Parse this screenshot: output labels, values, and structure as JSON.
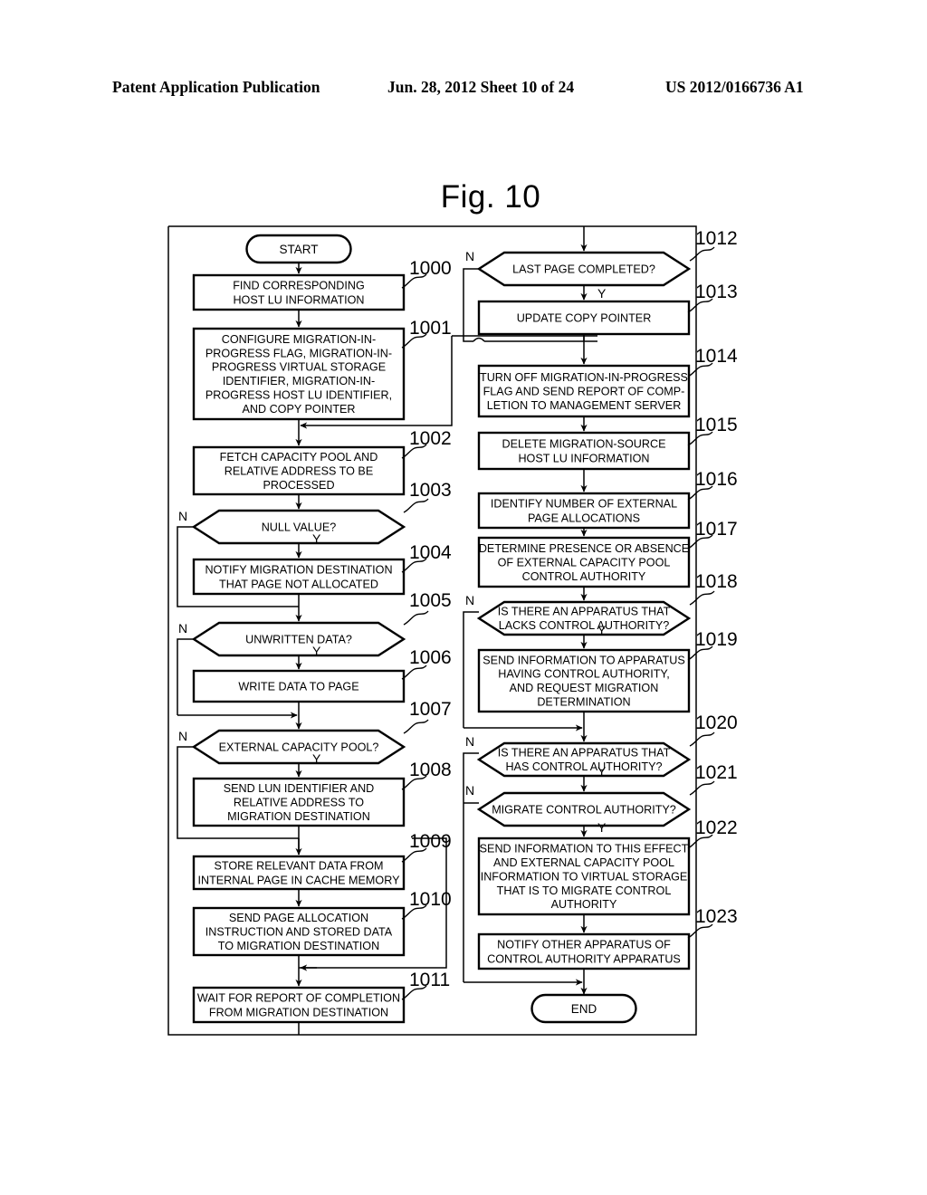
{
  "header": {
    "publication": "Patent Application Publication",
    "date_sheet": "Jun. 28, 2012  Sheet 10 of 24",
    "patent_number": "US 2012/0166736 A1"
  },
  "figure": {
    "title": "Fig. 10",
    "type": "flowchart",
    "terminators": {
      "start": "START",
      "end": "END"
    },
    "branch_labels": {
      "yes": "Y",
      "no": "N"
    },
    "colors": {
      "line": "#000000",
      "background": "#ffffff"
    },
    "left_column": [
      {
        "ref": "1000",
        "shape": "process",
        "text": "FIND CORRESPONDING HOST LU INFORMATION"
      },
      {
        "ref": "1001",
        "shape": "process",
        "text": "CONFIGURE MIGRATION-IN-PROGRESS FLAG, MIGRATION-IN-PROGRESS VIRTUAL STORAGE IDENTIFIER, MIGRATION-IN-PROGRESS HOST LU IDENTIFIER, AND COPY POINTER"
      },
      {
        "ref": "1002",
        "shape": "process",
        "text": "FETCH CAPACITY POOL AND RELATIVE ADDRESS TO BE PROCESSED"
      },
      {
        "ref": "1003",
        "shape": "decision",
        "text": "NULL VALUE?"
      },
      {
        "ref": "1004",
        "shape": "process",
        "text": "NOTIFY MIGRATION DESTINATION THAT PAGE NOT ALLOCATED"
      },
      {
        "ref": "1005",
        "shape": "decision",
        "text": "UNWRITTEN DATA?"
      },
      {
        "ref": "1006",
        "shape": "process",
        "text": "WRITE DATA TO PAGE"
      },
      {
        "ref": "1007",
        "shape": "decision",
        "text": "EXTERNAL CAPACITY POOL?"
      },
      {
        "ref": "1008",
        "shape": "process",
        "text": "SEND LUN IDENTIFIER AND RELATIVE ADDRESS TO MIGRATION DESTINATION"
      },
      {
        "ref": "1009",
        "shape": "process",
        "text": "STORE RELEVANT DATA FROM INTERNAL PAGE IN CACHE MEMORY"
      },
      {
        "ref": "1010",
        "shape": "process",
        "text": "SEND PAGE ALLOCATION INSTRUCTION AND STORED DATA TO MIGRATION DESTINATION"
      },
      {
        "ref": "1011",
        "shape": "process",
        "text": "WAIT FOR REPORT OF COMPLETION FROM MIGRATION DESTINATION"
      }
    ],
    "right_column": [
      {
        "ref": "1012",
        "shape": "decision",
        "text": "LAST PAGE COMPLETED?"
      },
      {
        "ref": "1013",
        "shape": "process",
        "text": "UPDATE COPY POINTER"
      },
      {
        "ref": "1014",
        "shape": "process",
        "text": "TURN OFF MIGRATION-IN-PROGRESS FLAG AND SEND REPORT OF COMPLETION TO MANAGEMENT SERVER"
      },
      {
        "ref": "1015",
        "shape": "process",
        "text": "DELETE MIGRATION-SOURCE HOST LU INFORMATION"
      },
      {
        "ref": "1016",
        "shape": "process",
        "text": "IDENTIFY NUMBER OF EXTERNAL PAGE ALLOCATIONS"
      },
      {
        "ref": "1017",
        "shape": "process",
        "text": "DETERMINE PRESENCE OR ABSENCE OF EXTERNAL CAPACITY POOL CONTROL AUTHORITY"
      },
      {
        "ref": "1018",
        "shape": "decision",
        "text": "IS THERE AN APPARATUS THAT LACKS CONTROL AUTHORITY?"
      },
      {
        "ref": "1019",
        "shape": "process",
        "text": "SEND INFORMATION TO APPARATUS HAVING CONTROL AUTHORITY, AND REQUEST MIGRATION DETERMINATION"
      },
      {
        "ref": "1020",
        "shape": "decision",
        "text": "IS THERE AN APPARATUS THAT HAS CONTROL AUTHORITY?"
      },
      {
        "ref": "1021",
        "shape": "decision",
        "text": "MIGRATE CONTROL AUTHORITY?"
      },
      {
        "ref": "1022",
        "shape": "process",
        "text": "SEND INFORMATION TO THIS EFFECT AND EXTERNAL CAPACITY POOL INFORMATION TO VIRTUAL STORAGE THAT IS TO MIGRATE CONTROL AUTHORITY"
      },
      {
        "ref": "1023",
        "shape": "process",
        "text": "NOTIFY OTHER APPARATUS OF CONTROL AUTHORITY APPARATUS"
      }
    ],
    "box_text_lines": {
      "1000": [
        "FIND CORRESPONDING",
        "HOST LU INFORMATION"
      ],
      "1001": [
        "CONFIGURE MIGRATION-IN-",
        "PROGRESS FLAG, MIGRATION-IN-",
        "PROGRESS VIRTUAL STORAGE",
        "IDENTIFIER, MIGRATION-IN-",
        "PROGRESS HOST LU IDENTIFIER,",
        "AND COPY POINTER"
      ],
      "1002": [
        "FETCH CAPACITY POOL AND",
        "RELATIVE ADDRESS TO BE",
        "PROCESSED"
      ],
      "1003": [
        "NULL VALUE?"
      ],
      "1004": [
        "NOTIFY MIGRATION DESTINATION",
        "THAT PAGE NOT ALLOCATED"
      ],
      "1005": [
        "UNWRITTEN DATA?"
      ],
      "1006": [
        "WRITE DATA TO PAGE"
      ],
      "1007": [
        "EXTERNAL CAPACITY POOL?"
      ],
      "1008": [
        "SEND LUN IDENTIFIER AND",
        "RELATIVE ADDRESS TO",
        "MIGRATION DESTINATION"
      ],
      "1009": [
        "STORE RELEVANT DATA FROM",
        "INTERNAL PAGE IN CACHE MEMORY"
      ],
      "1010": [
        "SEND PAGE ALLOCATION",
        "INSTRUCTION AND STORED DATA",
        "TO MIGRATION DESTINATION"
      ],
      "1011": [
        "WAIT FOR REPORT OF COMPLETION",
        "FROM MIGRATION DESTINATION"
      ],
      "1012": [
        "LAST PAGE COMPLETED?"
      ],
      "1013": [
        "UPDATE COPY POINTER"
      ],
      "1014": [
        "TURN OFF MIGRATION-IN-PROGRESS",
        "FLAG AND SEND REPORT OF COMP-",
        "LETION TO MANAGEMENT SERVER"
      ],
      "1015": [
        "DELETE MIGRATION-SOURCE",
        "HOST LU INFORMATION"
      ],
      "1016": [
        "IDENTIFY NUMBER OF EXTERNAL",
        "PAGE ALLOCATIONS"
      ],
      "1017": [
        "DETERMINE PRESENCE OR ABSENCE",
        "OF EXTERNAL CAPACITY POOL",
        "CONTROL AUTHORITY"
      ],
      "1018": [
        "IS THERE AN APPARATUS THAT",
        "LACKS CONTROL AUTHORITY?"
      ],
      "1019": [
        "SEND INFORMATION TO APPARATUS",
        "HAVING CONTROL AUTHORITY,",
        "AND REQUEST MIGRATION",
        "DETERMINATION"
      ],
      "1020": [
        "IS THERE AN APPARATUS THAT",
        "HAS CONTROL AUTHORITY?"
      ],
      "1021": [
        "MIGRATE CONTROL AUTHORITY?"
      ],
      "1022": [
        "SEND INFORMATION TO THIS EFFECT",
        "AND EXTERNAL CAPACITY POOL",
        "INFORMATION TO VIRTUAL STORAGE",
        "THAT IS TO MIGRATE CONTROL",
        "AUTHORITY"
      ],
      "1023": [
        "NOTIFY OTHER APPARATUS OF",
        "CONTROL AUTHORITY APPARATUS"
      ]
    }
  }
}
